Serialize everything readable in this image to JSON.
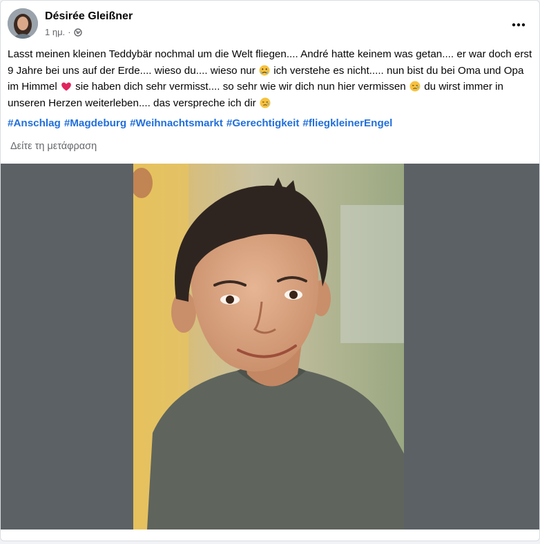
{
  "post": {
    "author": {
      "name": "Désirée Gleißner"
    },
    "timestamp": "1 ημ.",
    "separator": "·",
    "privacy_icon": "globe-icon",
    "more_icon": "more-options-icon",
    "text": {
      "part1": "Lasst meinen kleinen Teddybär nochmal um die Welt fliegen.... André hatte keinem was getan.... er war doch erst 9 Jahre bei uns auf der Erde.... wieso du.... wieso nur ",
      "part2": " ich verstehe es nicht..... nun bist du bei Oma und Opa im Himmel ",
      "part3": " sie haben dich sehr vermisst.... so sehr wie wir dich nun hier vermissen ",
      "part4": " du wirst immer in unseren Herzen weiterleben.... das verspreche ich dir ",
      "emoji_1": "crying-face-emoji",
      "emoji_2": "red-heart-emoji",
      "emoji_3": "sad-face-emoji",
      "emoji_4": "sad-face-emoji"
    },
    "hashtags": [
      "#Anschlag",
      "#Magdeburg",
      "#Weihnachtsmarkt",
      "#Gerechtigkeit",
      "#fliegkleinerEngel"
    ],
    "translate_label": "Δείτε τη μετάφραση"
  },
  "colors": {
    "hashtag": "#216fdb",
    "secondary_text": "#65676b",
    "media_background": "#5c6166",
    "heart": "#e0245e"
  }
}
